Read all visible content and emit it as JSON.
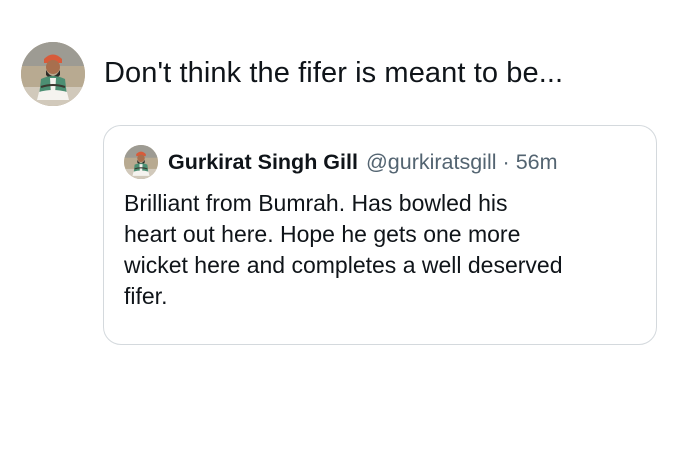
{
  "tweet": {
    "text": "Don't think the fifer is meant to be...",
    "avatar_icon": "user-avatar-icon"
  },
  "quote": {
    "name": "Gurkirat Singh Gill",
    "handle": "@gurkiratsgill",
    "separator": "·",
    "time": "56m",
    "avatar_icon": "user-avatar-icon",
    "body_lines": [
      "Brilliant from Bumrah. Has bowled his",
      "heart out here. Hope he gets one more",
      "wicket here and completes a well deserved",
      "fifer."
    ]
  },
  "colors": {
    "text": "#0f1419",
    "secondary_text": "#536471",
    "border": "#d4d9dd",
    "background": "#ffffff"
  }
}
